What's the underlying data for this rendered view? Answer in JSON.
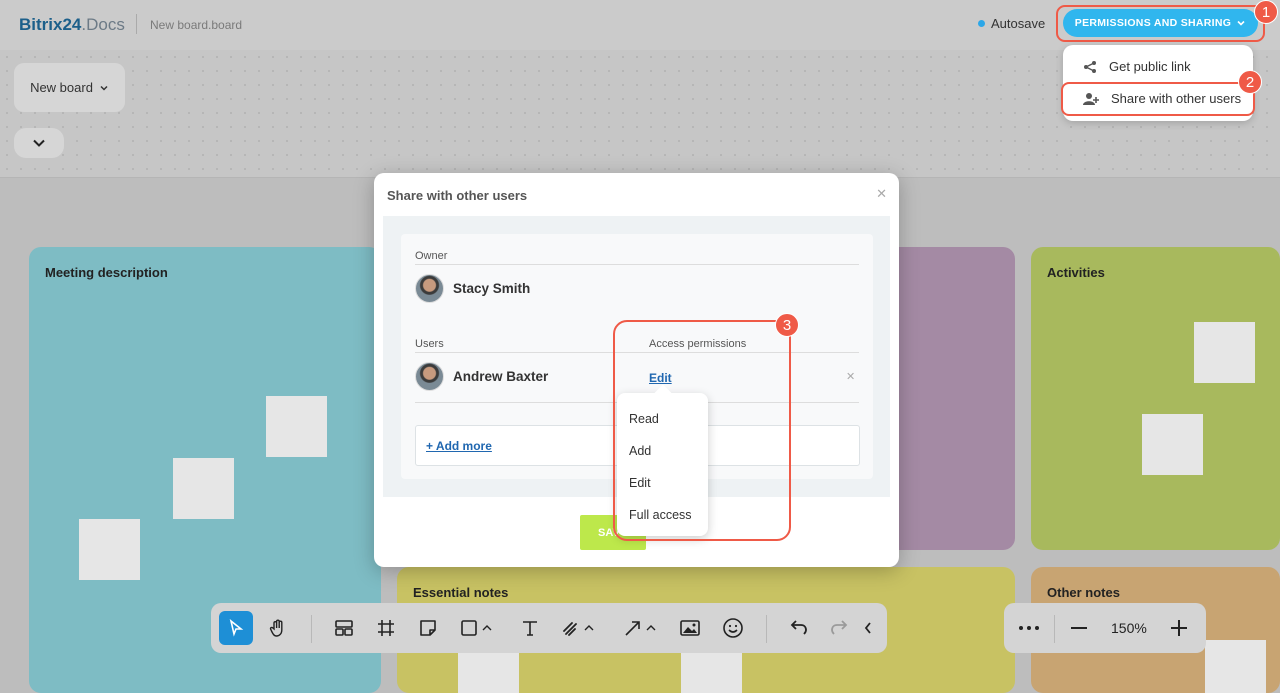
{
  "app": {
    "logo_main": "Bitrix24",
    "logo_suffix": ".Docs",
    "file_name": "New board.board"
  },
  "topbar": {
    "autosave": "Autosave",
    "permissions_button": "PERMISSIONS AND SHARING"
  },
  "share_menu": {
    "items": [
      {
        "label": "Get public link",
        "icon": "share-icon"
      },
      {
        "label": "Share with other users",
        "icon": "add-user-icon"
      }
    ]
  },
  "board": {
    "selector": "New board"
  },
  "panels": [
    {
      "title": "Meeting description",
      "color": "#7ebcc4"
    },
    {
      "title": "Activities",
      "color": "#a8b95d"
    },
    {
      "title": "Essential notes",
      "color": "#c8c263"
    },
    {
      "title": "Other notes",
      "color": "#c8a472"
    }
  ],
  "modal": {
    "title": "Share with other users",
    "owner_label": "Owner",
    "owner_name": "Stacy Smith",
    "users_label": "Users",
    "access_label": "Access permissions",
    "user_name": "Andrew Baxter",
    "user_permission": "Edit",
    "add_more": "+ Add more",
    "save": "SAV"
  },
  "permission_options": [
    "Read",
    "Add",
    "Edit",
    "Full access"
  ],
  "annotations": {
    "badge1": "1",
    "badge2": "2",
    "badge3": "3"
  },
  "zoom": {
    "value": "150%"
  },
  "colors": {
    "accent": "#30b6ee",
    "highlight": "#ef5a47",
    "save": "#bde84b"
  }
}
